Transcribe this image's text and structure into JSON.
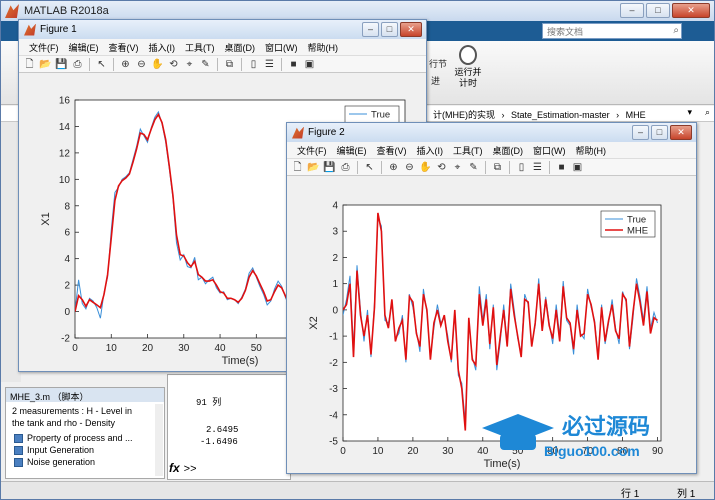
{
  "app": {
    "title": "MATLAB R2018a",
    "search_placeholder": "搜索文档",
    "ribbon_partial_1": "行节",
    "ribbon_partial_2": "进",
    "run_timed_label": "运行并\n计时",
    "address_parts": [
      "计(MHE)的实现",
      "›",
      "State_Estimation-master",
      "›",
      "MHE"
    ],
    "detail_title": "MHE_3.m （脚本）",
    "detail_desc": "2 measurements : H - Level in the tank and rho - Density",
    "detail_items": [
      "Property of process and ...",
      "Input Generation",
      "Noise generation"
    ],
    "cmd_lines": [
      "91 列",
      "2.6495",
      "-1.6496"
    ],
    "prompt_symbol": "fx",
    "prompt_caret": ">>",
    "status_row": "行 1",
    "status_col": "列 1"
  },
  "figure1": {
    "title": "Figure 1",
    "menu": [
      "文件(F)",
      "编辑(E)",
      "查看(V)",
      "插入(I)",
      "工具(T)",
      "桌面(D)",
      "窗口(W)",
      "帮助(H)"
    ]
  },
  "figure2": {
    "title": "Figure 2",
    "menu": [
      "文件(F)",
      "编辑(E)",
      "查看(V)",
      "插入(I)",
      "工具(T)",
      "桌面(D)",
      "窗口(W)",
      "帮助(H)"
    ]
  },
  "watermark": {
    "brand": "必过源码",
    "url": "Biguo100.com"
  },
  "chart_data": [
    {
      "type": "line",
      "xlabel": "Time(s)",
      "ylabel": "X1",
      "xlim": [
        0,
        91
      ],
      "ylim": [
        -2,
        16
      ],
      "xticks": [
        0,
        10,
        20,
        30,
        40,
        50,
        60
      ],
      "yticks": [
        -2,
        0,
        2,
        4,
        6,
        8,
        10,
        12,
        14,
        16
      ],
      "legend_position": "top-right",
      "series": [
        {
          "name": "True",
          "color": "#3a8fd8",
          "x": [
            0,
            1,
            2,
            3,
            4,
            5,
            6,
            7,
            8,
            9,
            10,
            11,
            12,
            13,
            14,
            15,
            16,
            17,
            18,
            19,
            20,
            21,
            22,
            23,
            24,
            25,
            26,
            27,
            28,
            29,
            30,
            31,
            32,
            33,
            34,
            35,
            36,
            37,
            38,
            39,
            40,
            41,
            42,
            43,
            44,
            45,
            46,
            47,
            48,
            49,
            50,
            51,
            52,
            53,
            54,
            55,
            56,
            57,
            58,
            59,
            60,
            61,
            62,
            63,
            64
          ],
          "values": [
            0.0,
            2.4,
            0.6,
            0.2,
            1.0,
            0.8,
            0.3,
            -0.5,
            1.4,
            2.6,
            6.2,
            9.0,
            9.4,
            10.0,
            10.2,
            10.5,
            11.5,
            12.5,
            13.8,
            13.3,
            12.8,
            13.9,
            14.7,
            15.1,
            14.2,
            12.8,
            10.8,
            8.6,
            5.2,
            3.9,
            4.3,
            3.4,
            3.3,
            4.1,
            2.4,
            2.6,
            2.1,
            2.4,
            2.6,
            1.8,
            1.4,
            1.5,
            0.9,
            1.0,
            0.9,
            0.6,
            1.1,
            1.7,
            2.9,
            3.3,
            2.6,
            1.9,
            1.3,
            0.5,
            0.8,
            1.7,
            2.3,
            1.9,
            1.1,
            0.4,
            1.0,
            1.9,
            1.6,
            1.1,
            0.7
          ]
        },
        {
          "name": "MHE",
          "color": "#e01010",
          "x": [
            0,
            1,
            2,
            3,
            4,
            5,
            6,
            7,
            8,
            9,
            10,
            11,
            12,
            13,
            14,
            15,
            16,
            17,
            18,
            19,
            20,
            21,
            22,
            23,
            24,
            25,
            26,
            27,
            28,
            29,
            30,
            31,
            32,
            33,
            34,
            35,
            36,
            37,
            38,
            39,
            40,
            41,
            42,
            43,
            44,
            45,
            46,
            47,
            48,
            49,
            50,
            51,
            52,
            53,
            54,
            55,
            56,
            57,
            58,
            59,
            60,
            61,
            62,
            63,
            64
          ],
          "values": [
            0.0,
            1.2,
            0.9,
            0.4,
            0.9,
            0.7,
            0.5,
            0.3,
            1.3,
            2.8,
            5.6,
            8.4,
            9.5,
            9.9,
            10.1,
            10.4,
            11.3,
            12.3,
            13.5,
            13.4,
            13.0,
            13.8,
            14.5,
            14.9,
            14.3,
            13.0,
            11.0,
            8.8,
            5.8,
            4.3,
            4.2,
            3.7,
            3.4,
            3.8,
            2.8,
            2.6,
            2.3,
            2.3,
            2.4,
            2.0,
            1.5,
            1.4,
            1.0,
            1.0,
            0.9,
            0.7,
            1.0,
            1.6,
            2.6,
            3.1,
            2.7,
            2.1,
            1.5,
            0.8,
            0.9,
            1.5,
            2.0,
            1.8,
            1.2,
            0.6,
            0.9,
            1.6,
            1.5,
            1.2,
            0.8
          ]
        }
      ]
    },
    {
      "type": "line",
      "xlabel": "Time(s)",
      "ylabel": "X2",
      "xlim": [
        0,
        91
      ],
      "ylim": [
        -5,
        4
      ],
      "xticks": [
        0,
        10,
        20,
        30,
        40,
        50,
        60,
        70,
        80,
        90
      ],
      "yticks": [
        -5,
        -4,
        -3,
        -2,
        -1,
        0,
        1,
        2,
        3,
        4
      ],
      "legend_position": "top-right",
      "series": [
        {
          "name": "True",
          "color": "#3a8fd8",
          "x": [
            0,
            1,
            2,
            3,
            4,
            5,
            6,
            7,
            8,
            9,
            10,
            11,
            12,
            13,
            14,
            15,
            16,
            17,
            18,
            19,
            20,
            21,
            22,
            23,
            24,
            25,
            26,
            27,
            28,
            29,
            30,
            31,
            32,
            33,
            34,
            35,
            36,
            37,
            38,
            39,
            40,
            41,
            42,
            43,
            44,
            45,
            46,
            47,
            48,
            49,
            50,
            51,
            52,
            53,
            54,
            55,
            56,
            57,
            58,
            59,
            60,
            61,
            62,
            63,
            64,
            65,
            66,
            67,
            68,
            69,
            70,
            71,
            72,
            73,
            74,
            75,
            76,
            77,
            78,
            79,
            80,
            81,
            82,
            83,
            84,
            85,
            86,
            87,
            88,
            89,
            90
          ],
          "values": [
            -0.2,
            0.4,
            1.3,
            -1.5,
            1.7,
            0.0,
            -1.2,
            0.0,
            -1.8,
            0.3,
            3.5,
            3.2,
            -0.4,
            -0.5,
            0.2,
            -1.1,
            -0.9,
            -0.2,
            -2.0,
            0.6,
            0.1,
            -0.8,
            -1.6,
            0.8,
            -0.1,
            -1.8,
            -0.7,
            0.2,
            -0.5,
            -0.3,
            -1.0,
            -2.0,
            -0.1,
            -2.5,
            -2.8,
            -4.3,
            -0.5,
            -1.8,
            -2.3,
            0.9,
            -0.4,
            0.6,
            -1.5,
            0.2,
            -2.3,
            -1.2,
            0.2,
            -1.3,
            1.0,
            0.0,
            -1.1,
            -1.6,
            0.6,
            0.2,
            -1.3,
            -0.6,
            1.2,
            -0.7,
            0.5,
            -0.5,
            -1.3,
            0.2,
            -1.0,
            1.1,
            -0.4,
            -0.6,
            -1.7,
            0.2,
            -0.9,
            -1.1,
            0.8,
            0.1,
            -0.4,
            -1.8,
            0.2,
            -1.3,
            -0.5,
            0.4,
            -0.7,
            -1.3,
            0.7,
            0.3,
            -1.5,
            -0.3,
            1.2,
            0.5,
            -0.4,
            0.9,
            -0.7,
            -0.1,
            -0.5
          ]
        },
        {
          "name": "MHE",
          "color": "#e01010",
          "x": [
            0,
            1,
            2,
            3,
            4,
            5,
            6,
            7,
            8,
            9,
            10,
            11,
            12,
            13,
            14,
            15,
            16,
            17,
            18,
            19,
            20,
            21,
            22,
            23,
            24,
            25,
            26,
            27,
            28,
            29,
            30,
            31,
            32,
            33,
            34,
            35,
            36,
            37,
            38,
            39,
            40,
            41,
            42,
            43,
            44,
            45,
            46,
            47,
            48,
            49,
            50,
            51,
            52,
            53,
            54,
            55,
            56,
            57,
            58,
            59,
            60,
            61,
            62,
            63,
            64,
            65,
            66,
            67,
            68,
            69,
            70,
            71,
            72,
            73,
            74,
            75,
            76,
            77,
            78,
            79,
            80,
            81,
            82,
            83,
            84,
            85,
            86,
            87,
            88,
            89,
            90
          ],
          "values": [
            0.0,
            0.2,
            1.0,
            -1.8,
            1.5,
            -0.2,
            -1.0,
            -0.2,
            -1.7,
            0.1,
            3.7,
            3.0,
            -0.2,
            -0.7,
            0.4,
            -1.2,
            -0.7,
            -0.4,
            -1.9,
            0.5,
            0.3,
            -0.9,
            -1.4,
            0.6,
            0.0,
            -1.9,
            -0.5,
            0.0,
            -0.6,
            -0.2,
            -1.2,
            -1.9,
            0.0,
            -2.3,
            -3.0,
            -4.6,
            -0.3,
            -1.9,
            -2.1,
            0.6,
            -0.6,
            0.4,
            -1.3,
            0.1,
            -2.1,
            -1.0,
            0.0,
            -1.4,
            0.8,
            -0.2,
            -1.0,
            -1.8,
            0.4,
            0.3,
            -1.4,
            -0.5,
            1.0,
            -0.8,
            0.4,
            -0.6,
            -1.1,
            0.0,
            -1.2,
            0.9,
            -0.3,
            -0.5,
            -1.5,
            0.0,
            -1.0,
            -0.9,
            0.6,
            0.2,
            -0.5,
            -1.9,
            0.1,
            -1.2,
            -0.4,
            0.2,
            -0.8,
            -1.1,
            0.6,
            0.4,
            -1.4,
            -0.1,
            1.0,
            0.3,
            -0.6,
            0.7,
            -0.9,
            -0.3,
            -0.4
          ]
        }
      ]
    }
  ]
}
